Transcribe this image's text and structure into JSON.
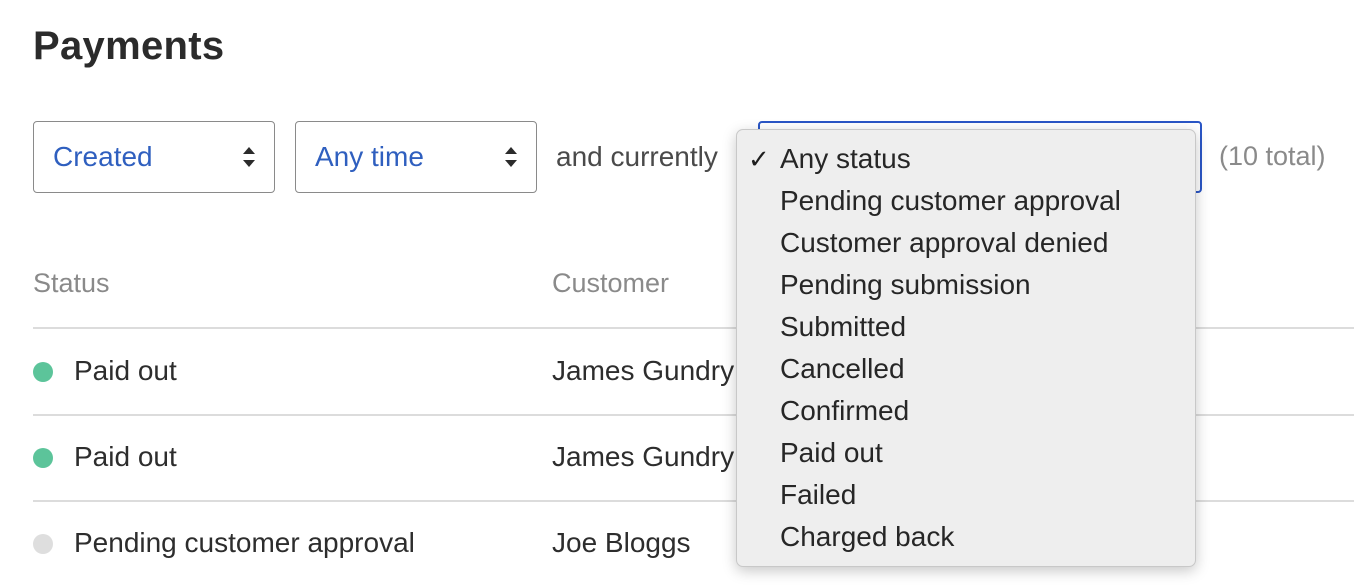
{
  "page": {
    "title": "Payments"
  },
  "filters": {
    "date_field": {
      "value": "Created"
    },
    "time_range": {
      "value": "Any time"
    },
    "connector_text": "and currently",
    "status": {
      "selected": "Any status"
    },
    "total_count": "(10 total)"
  },
  "table": {
    "columns": [
      "Status",
      "Customer"
    ],
    "rows": [
      {
        "status": "Paid out",
        "status_color": "#5cc49a",
        "customer": "James Gundry"
      },
      {
        "status": "Paid out",
        "status_color": "#5cc49a",
        "customer": "James Gundry"
      },
      {
        "status": "Pending customer approval",
        "status_color": "#dedede",
        "customer": "Joe Bloggs"
      }
    ]
  },
  "status_dropdown": {
    "options": [
      "Any status",
      "Pending customer approval",
      "Customer approval denied",
      "Pending submission",
      "Submitted",
      "Cancelled",
      "Confirmed",
      "Paid out",
      "Failed",
      "Charged back"
    ],
    "selected_index": 0,
    "check_glyph": "✓"
  },
  "colors": {
    "accent": "#2f5fbf",
    "focus_border": "#2a56c6",
    "paid_out": "#5cc49a",
    "pending": "#dedede"
  }
}
